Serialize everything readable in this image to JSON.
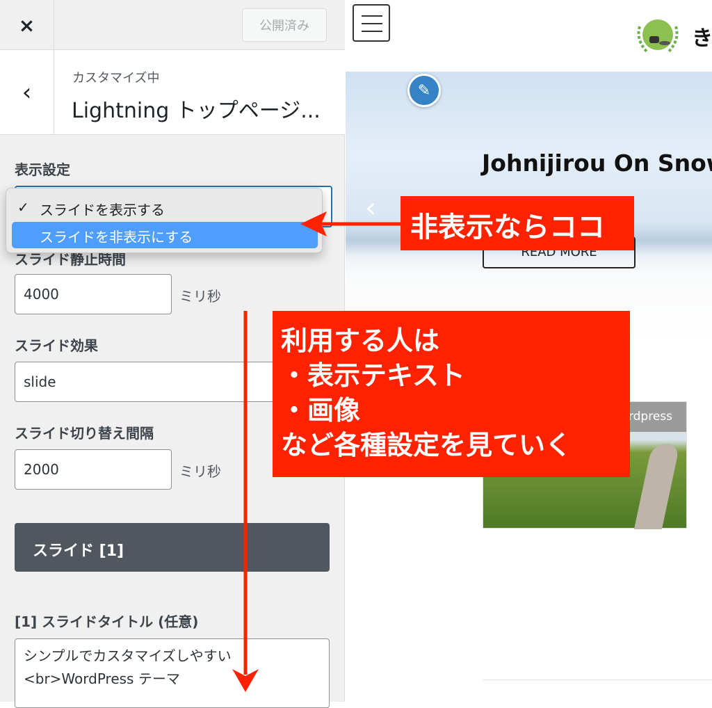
{
  "sidebar": {
    "close_icon": "×",
    "publish_label": "公開済み",
    "back_icon": "‹",
    "subtitle": "カスタマイズ中",
    "title": "Lightning トップページ...",
    "display_label": "表示設定",
    "display_options": [
      {
        "label": "スライドを表示する",
        "checked": true
      },
      {
        "label": "スライドを非表示にする",
        "highlighted": true
      }
    ],
    "checkmark": "✓",
    "pause_label": "スライド静止時間",
    "pause_value": "4000",
    "pause_unit": "ミリ秒",
    "effect_label": "スライド効果",
    "effect_value": "slide",
    "interval_label": "スライド切り替え間隔",
    "interval_value": "2000",
    "interval_unit": "ミリ秒",
    "slide_button": "スライド [1]",
    "slide_title_label": "[1] スライドタイトル (任意)",
    "slide_title_value": "シンプルでカスタマイズしやすい\n<br>WordPress テーマ"
  },
  "preview": {
    "logo_text": "き",
    "headline": "Johnijirou On Snow",
    "read_more": "READ MORE",
    "card_caption": "Wordpress"
  },
  "annotations": {
    "note1": "非表示ならココ",
    "note2": "利用する人は\n・表示テキスト\n・画像\nなど各種設定を見ていく",
    "color": "#ff2200"
  }
}
